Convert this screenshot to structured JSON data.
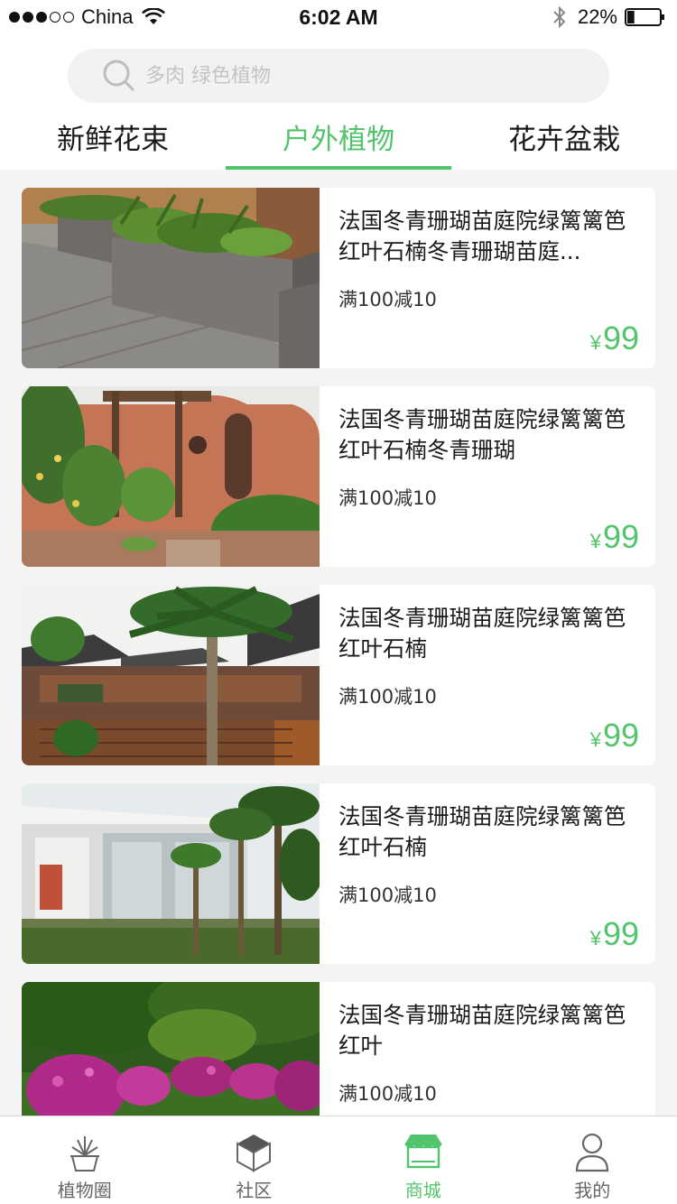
{
  "status": {
    "carrier": "China",
    "time": "6:02 AM",
    "battery": "22%",
    "signal_bars": 3,
    "battery_level": 0.22
  },
  "search": {
    "placeholder": "多肉 绿色植物",
    "icon": "search-icon"
  },
  "tabs": [
    {
      "label": "新鲜花束",
      "active": false
    },
    {
      "label": "户外植物",
      "active": true
    },
    {
      "label": "花卉盆栽",
      "active": false
    }
  ],
  "products": [
    {
      "title": "法国冬青珊瑚苗庭院绿篱篱笆红叶石楠冬青珊瑚苗庭...",
      "promo": "满100减10",
      "currency": "¥",
      "price": "99"
    },
    {
      "title": "法国冬青珊瑚苗庭院绿篱篱笆红叶石楠冬青珊瑚",
      "promo": "满100减10",
      "currency": "¥",
      "price": "99"
    },
    {
      "title": "法国冬青珊瑚苗庭院绿篱篱笆红叶石楠",
      "promo": "满100减10",
      "currency": "¥",
      "price": "99"
    },
    {
      "title": "法国冬青珊瑚苗庭院绿篱篱笆红叶石楠",
      "promo": "满100减10",
      "currency": "¥",
      "price": "99"
    },
    {
      "title": "法国冬青珊瑚苗庭院绿篱篱笆红叶",
      "promo": "满100减10",
      "currency": "¥",
      "price": "99"
    }
  ],
  "tabbar": [
    {
      "label": "植物圈",
      "icon": "plant-pot-icon",
      "active": false
    },
    {
      "label": "社区",
      "icon": "cube-icon",
      "active": false
    },
    {
      "label": "商城",
      "icon": "store-icon",
      "active": true
    },
    {
      "label": "我的",
      "icon": "user-icon",
      "active": false
    }
  ],
  "colors": {
    "accent": "#52c46b",
    "background": "#f4f4f4",
    "card": "#ffffff",
    "text": "#1a1a1a"
  }
}
